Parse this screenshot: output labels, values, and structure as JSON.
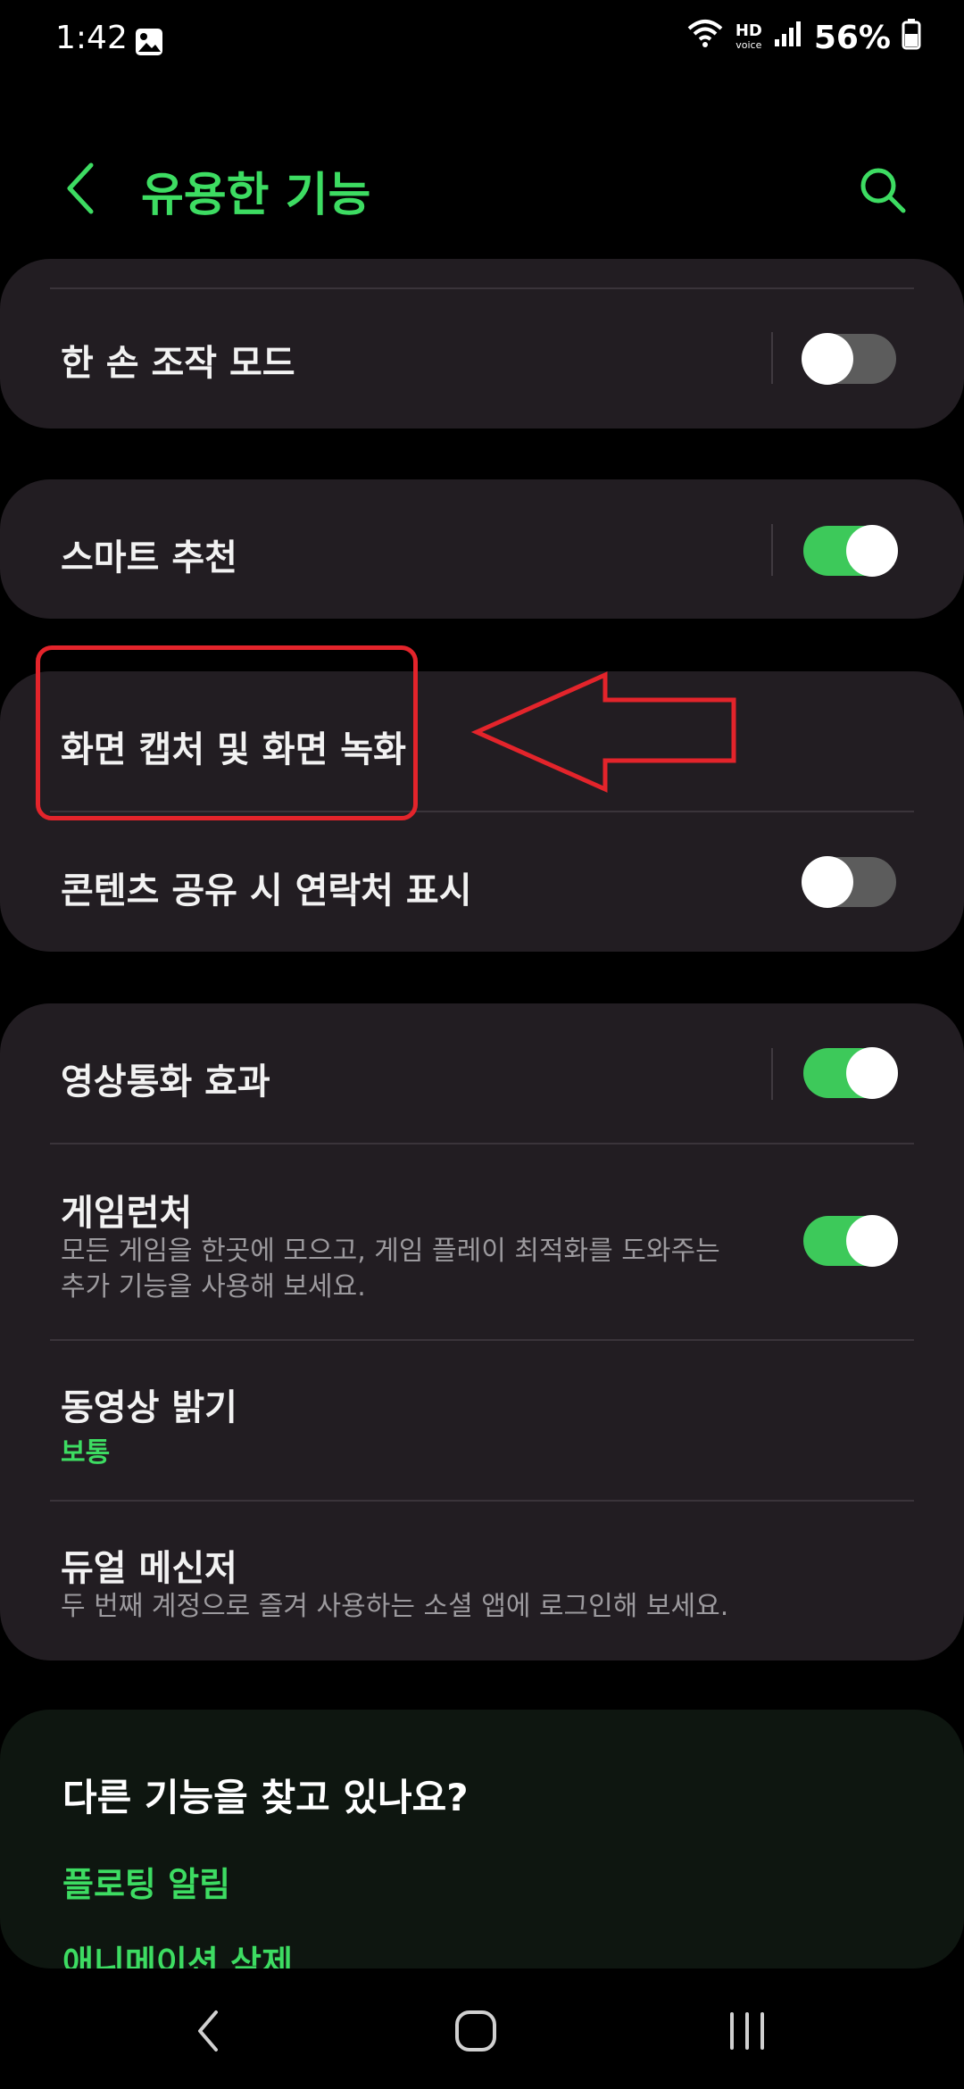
{
  "status_bar": {
    "time": "1:42",
    "hd_label": "HD",
    "hd_sub": "voice",
    "battery": "56%"
  },
  "header": {
    "title": "유용한 기능",
    "back_icon": "chevron-left-icon",
    "search_icon": "search-icon"
  },
  "colors": {
    "accent": "#3ddc62",
    "card": "#221d22",
    "toggle_on": "#3dc95a",
    "toggle_off": "#5c5c5c",
    "annotation": "#e3242b"
  },
  "settings": {
    "one_hand": {
      "title": "한 손 조작 모드",
      "enabled": false
    },
    "smart_suggest": {
      "title": "스마트 추천",
      "enabled": true
    },
    "screen_capture": {
      "title": "화면 캡처 및 화면 녹화"
    },
    "contact_share": {
      "title": "콘텐츠 공유 시 연락처 표시",
      "enabled": false
    },
    "video_call": {
      "title": "영상통화 효과",
      "enabled": true
    },
    "game_launcher": {
      "title": "게임런처",
      "sub_line1": "모든 게임을 한곳에 모으고, 게임 플레이 최적화를 도와주는",
      "sub_line2": "추가 기능을 사용해 보세요.",
      "enabled": true
    },
    "video_brightness": {
      "title": "동영상 밝기",
      "value": "보통"
    },
    "dual_messenger": {
      "title": "듀얼 메신저",
      "sub": "두 번째 계정으로 즐겨 사용하는 소셜 앱에 로그인해 보세요."
    }
  },
  "suggestions": {
    "title": "다른 기능을 찾고 있나요?",
    "links": [
      "플로팅 알림",
      "애니메이션 삭제"
    ]
  },
  "navbar": {
    "back_icon": "nav-back-icon",
    "home_icon": "home-icon",
    "recents_icon": "recents-icon"
  }
}
